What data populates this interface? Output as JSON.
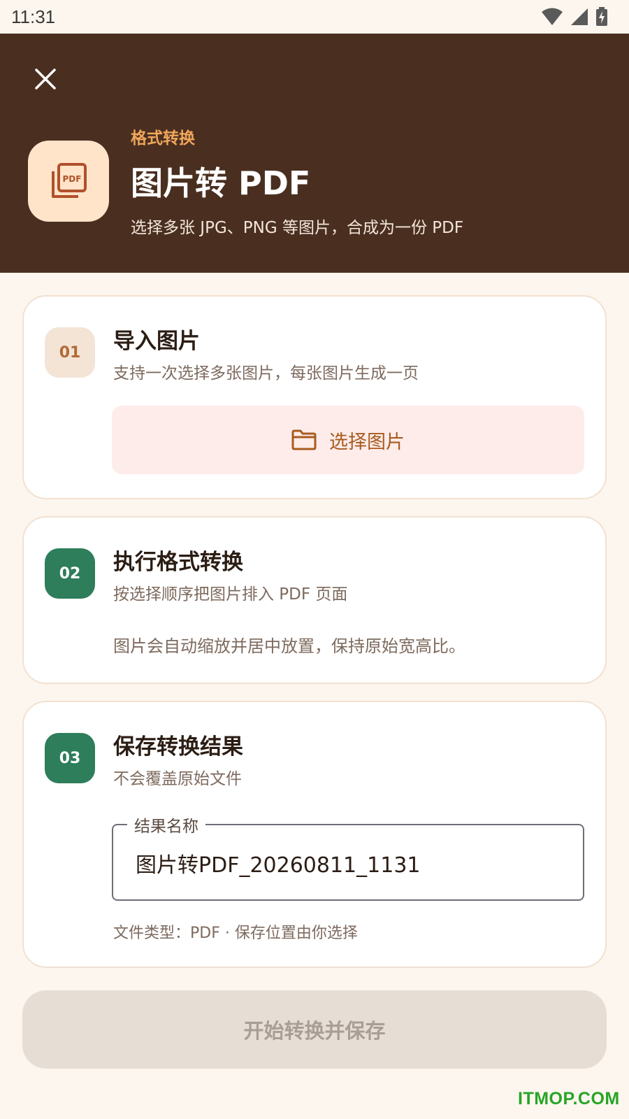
{
  "status_bar": {
    "time": "11:31"
  },
  "header": {
    "close_icon": "close-icon",
    "app_icon": "pdf-stack-icon",
    "category": "格式转换",
    "title": "图片转 PDF",
    "subtitle": "选择多张 JPG、PNG 等图片，合成为一份 PDF"
  },
  "steps": [
    {
      "number": "01",
      "title": "导入图片",
      "description": "支持一次选择多张图片，每张图片生成一页",
      "button_label": "选择图片",
      "button_icon": "folder-icon"
    },
    {
      "number": "02",
      "title": "执行格式转换",
      "description": "按选择顺序把图片排入 PDF 页面",
      "note": "图片会自动缩放并居中放置，保持原始宽高比。"
    },
    {
      "number": "03",
      "title": "保存转换结果",
      "description": "不会覆盖原始文件",
      "field_label": "结果名称",
      "field_value": "图片转PDF_20260811_1131",
      "file_info": "文件类型：PDF · 保存位置由你选择"
    }
  ],
  "action": {
    "start_label": "开始转换并保存"
  },
  "watermark": "ITMOP.COM",
  "colors": {
    "header_bg": "#4A2F21",
    "page_bg": "#FDF6EE",
    "accent_orange": "#F0A65A",
    "step_green": "#2E7D5B",
    "disabled_button": "#E6DDD5"
  }
}
